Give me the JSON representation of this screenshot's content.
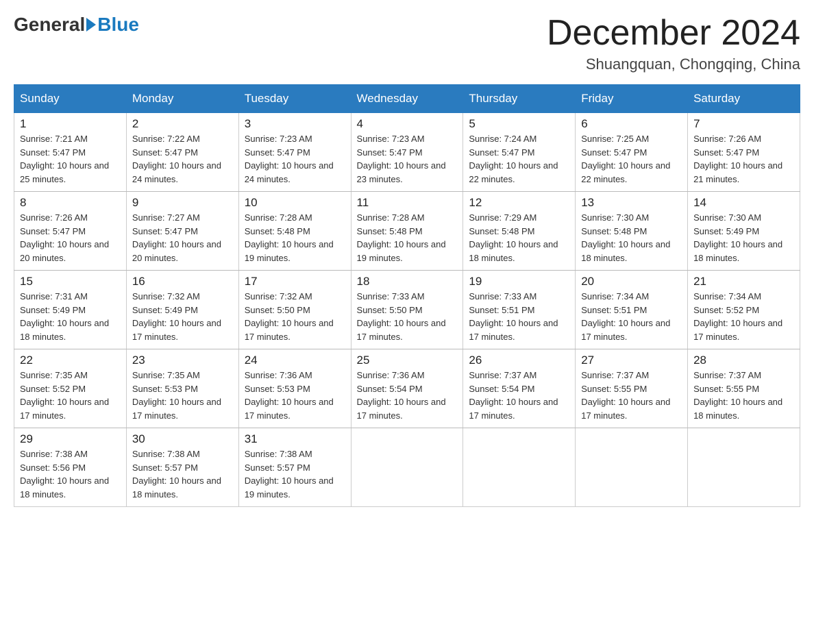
{
  "header": {
    "logo_general": "General",
    "logo_blue": "Blue",
    "month_title": "December 2024",
    "location": "Shuangquan, Chongqing, China"
  },
  "days_of_week": [
    "Sunday",
    "Monday",
    "Tuesday",
    "Wednesday",
    "Thursday",
    "Friday",
    "Saturday"
  ],
  "weeks": [
    [
      {
        "day": "1",
        "sunrise": "7:21 AM",
        "sunset": "5:47 PM",
        "daylight": "10 hours and 25 minutes."
      },
      {
        "day": "2",
        "sunrise": "7:22 AM",
        "sunset": "5:47 PM",
        "daylight": "10 hours and 24 minutes."
      },
      {
        "day": "3",
        "sunrise": "7:23 AM",
        "sunset": "5:47 PM",
        "daylight": "10 hours and 24 minutes."
      },
      {
        "day": "4",
        "sunrise": "7:23 AM",
        "sunset": "5:47 PM",
        "daylight": "10 hours and 23 minutes."
      },
      {
        "day": "5",
        "sunrise": "7:24 AM",
        "sunset": "5:47 PM",
        "daylight": "10 hours and 22 minutes."
      },
      {
        "day": "6",
        "sunrise": "7:25 AM",
        "sunset": "5:47 PM",
        "daylight": "10 hours and 22 minutes."
      },
      {
        "day": "7",
        "sunrise": "7:26 AM",
        "sunset": "5:47 PM",
        "daylight": "10 hours and 21 minutes."
      }
    ],
    [
      {
        "day": "8",
        "sunrise": "7:26 AM",
        "sunset": "5:47 PM",
        "daylight": "10 hours and 20 minutes."
      },
      {
        "day": "9",
        "sunrise": "7:27 AM",
        "sunset": "5:47 PM",
        "daylight": "10 hours and 20 minutes."
      },
      {
        "day": "10",
        "sunrise": "7:28 AM",
        "sunset": "5:48 PM",
        "daylight": "10 hours and 19 minutes."
      },
      {
        "day": "11",
        "sunrise": "7:28 AM",
        "sunset": "5:48 PM",
        "daylight": "10 hours and 19 minutes."
      },
      {
        "day": "12",
        "sunrise": "7:29 AM",
        "sunset": "5:48 PM",
        "daylight": "10 hours and 18 minutes."
      },
      {
        "day": "13",
        "sunrise": "7:30 AM",
        "sunset": "5:48 PM",
        "daylight": "10 hours and 18 minutes."
      },
      {
        "day": "14",
        "sunrise": "7:30 AM",
        "sunset": "5:49 PM",
        "daylight": "10 hours and 18 minutes."
      }
    ],
    [
      {
        "day": "15",
        "sunrise": "7:31 AM",
        "sunset": "5:49 PM",
        "daylight": "10 hours and 18 minutes."
      },
      {
        "day": "16",
        "sunrise": "7:32 AM",
        "sunset": "5:49 PM",
        "daylight": "10 hours and 17 minutes."
      },
      {
        "day": "17",
        "sunrise": "7:32 AM",
        "sunset": "5:50 PM",
        "daylight": "10 hours and 17 minutes."
      },
      {
        "day": "18",
        "sunrise": "7:33 AM",
        "sunset": "5:50 PM",
        "daylight": "10 hours and 17 minutes."
      },
      {
        "day": "19",
        "sunrise": "7:33 AM",
        "sunset": "5:51 PM",
        "daylight": "10 hours and 17 minutes."
      },
      {
        "day": "20",
        "sunrise": "7:34 AM",
        "sunset": "5:51 PM",
        "daylight": "10 hours and 17 minutes."
      },
      {
        "day": "21",
        "sunrise": "7:34 AM",
        "sunset": "5:52 PM",
        "daylight": "10 hours and 17 minutes."
      }
    ],
    [
      {
        "day": "22",
        "sunrise": "7:35 AM",
        "sunset": "5:52 PM",
        "daylight": "10 hours and 17 minutes."
      },
      {
        "day": "23",
        "sunrise": "7:35 AM",
        "sunset": "5:53 PM",
        "daylight": "10 hours and 17 minutes."
      },
      {
        "day": "24",
        "sunrise": "7:36 AM",
        "sunset": "5:53 PM",
        "daylight": "10 hours and 17 minutes."
      },
      {
        "day": "25",
        "sunrise": "7:36 AM",
        "sunset": "5:54 PM",
        "daylight": "10 hours and 17 minutes."
      },
      {
        "day": "26",
        "sunrise": "7:37 AM",
        "sunset": "5:54 PM",
        "daylight": "10 hours and 17 minutes."
      },
      {
        "day": "27",
        "sunrise": "7:37 AM",
        "sunset": "5:55 PM",
        "daylight": "10 hours and 17 minutes."
      },
      {
        "day": "28",
        "sunrise": "7:37 AM",
        "sunset": "5:55 PM",
        "daylight": "10 hours and 18 minutes."
      }
    ],
    [
      {
        "day": "29",
        "sunrise": "7:38 AM",
        "sunset": "5:56 PM",
        "daylight": "10 hours and 18 minutes."
      },
      {
        "day": "30",
        "sunrise": "7:38 AM",
        "sunset": "5:57 PM",
        "daylight": "10 hours and 18 minutes."
      },
      {
        "day": "31",
        "sunrise": "7:38 AM",
        "sunset": "5:57 PM",
        "daylight": "10 hours and 19 minutes."
      },
      null,
      null,
      null,
      null
    ]
  ],
  "labels": {
    "sunrise": "Sunrise:",
    "sunset": "Sunset:",
    "daylight": "Daylight:"
  }
}
